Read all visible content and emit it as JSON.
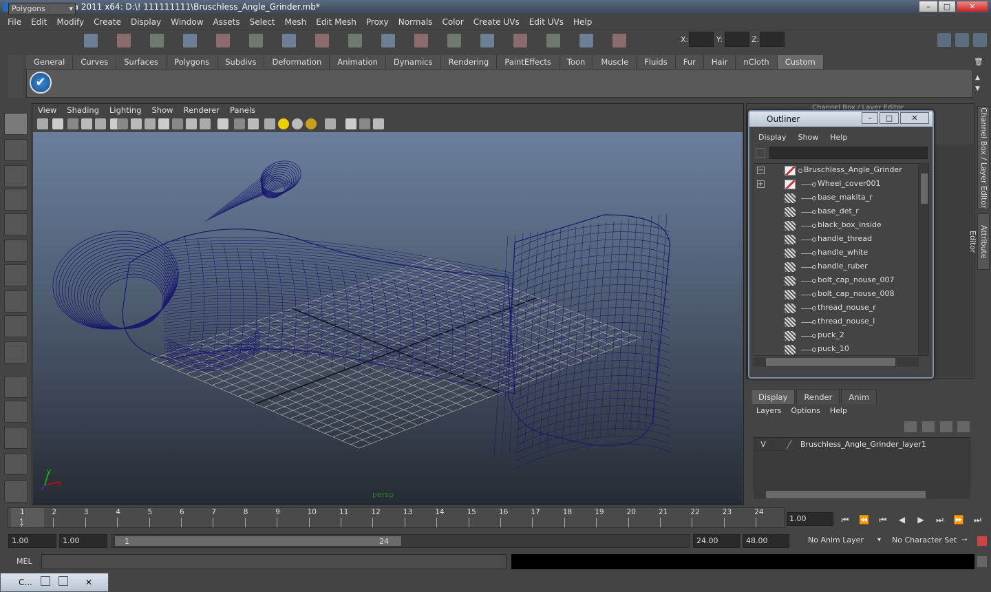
{
  "window": {
    "title": "Autodesk Maya 2011 x64: D:\\! 111111111\\Bruschless_Angle_Grinder.mb*",
    "min": "–",
    "max": "□",
    "close": "✕"
  },
  "menubar": [
    "File",
    "Edit",
    "Modify",
    "Create",
    "Display",
    "Window",
    "Assets",
    "Select",
    "Mesh",
    "Edit Mesh",
    "Proxy",
    "Normals",
    "Color",
    "Create UVs",
    "Edit UVs",
    "Help"
  ],
  "status": {
    "mode": "Polygons",
    "x_label": "X:",
    "y_label": "Y:",
    "z_label": "Z:"
  },
  "shelf": {
    "tabs": [
      "General",
      "Curves",
      "Surfaces",
      "Polygons",
      "Subdivs",
      "Deformation",
      "Animation",
      "Dynamics",
      "Rendering",
      "PaintEffects",
      "Toon",
      "Muscle",
      "Fluids",
      "Fur",
      "Hair",
      "nCloth",
      "Custom"
    ],
    "active_tab": "Custom",
    "check_icon": "✔"
  },
  "viewport": {
    "menu": [
      "View",
      "Shading",
      "Lighting",
      "Show",
      "Renderer",
      "Panels"
    ],
    "camera_label": "persp",
    "axis_x": "x",
    "axis_y": "y",
    "wire_color": "#1a1a6e"
  },
  "outliner": {
    "title": "Outliner",
    "menu": [
      "Display",
      "Show",
      "Help"
    ],
    "items": [
      {
        "label": "Bruschless_Angle_Grinder",
        "icon": "group-icon",
        "expander": "−"
      },
      {
        "label": "Wheel_cover001",
        "icon": "group-icon",
        "expander": "+"
      },
      {
        "label": "base_makita_r",
        "icon": "mesh-icon"
      },
      {
        "label": "base_det_r",
        "icon": "mesh-icon"
      },
      {
        "label": "black_box_inside",
        "icon": "mesh-icon"
      },
      {
        "label": "handle_thread",
        "icon": "mesh-icon"
      },
      {
        "label": "handle_white",
        "icon": "mesh-icon"
      },
      {
        "label": "handle_ruber",
        "icon": "mesh-icon"
      },
      {
        "label": "bolt_cap_nouse_007",
        "icon": "mesh-icon"
      },
      {
        "label": "bolt_cap_nouse_008",
        "icon": "mesh-icon"
      },
      {
        "label": "thread_nouse_r",
        "icon": "mesh-icon"
      },
      {
        "label": "thread_nouse_l",
        "icon": "mesh-icon"
      },
      {
        "label": "puck_2",
        "icon": "mesh-icon"
      },
      {
        "label": "puck_10",
        "icon": "mesh-icon"
      }
    ]
  },
  "channel_box_title": "Channel Box / Layer Editor",
  "side_tabs": [
    "Channel Box / Layer Editor",
    "Attribute Editor"
  ],
  "layer_editor": {
    "tabs": [
      "Display",
      "Render",
      "Anim"
    ],
    "active_tab": "Display",
    "menu": [
      "Layers",
      "Options",
      "Help"
    ],
    "layer": {
      "visible": "V",
      "name": "Bruschless_Angle_Grinder_layer1"
    }
  },
  "timeline": {
    "ticks": [
      "1",
      "2",
      "3",
      "4",
      "5",
      "6",
      "7",
      "8",
      "9",
      "10",
      "11",
      "12",
      "13",
      "14",
      "15",
      "16",
      "17",
      "18",
      "19",
      "20",
      "21",
      "22",
      "23",
      "24"
    ],
    "current_frame_label": "1",
    "current_time": "1.00",
    "playback": [
      "⏮",
      "⏪",
      "⏮",
      "◀",
      "▶",
      "⏭",
      "⏩",
      "⏭"
    ]
  },
  "range": {
    "start_time": "1.00",
    "start_range": "1.00",
    "range_start_label": "1",
    "range_end_label": "24",
    "end_range": "24.00",
    "end_time": "48.00",
    "anim_layer": "No Anim Layer",
    "character_set": "No Character Set"
  },
  "cmdline": {
    "label": "MEL"
  },
  "minimized": {
    "title": "C..."
  }
}
